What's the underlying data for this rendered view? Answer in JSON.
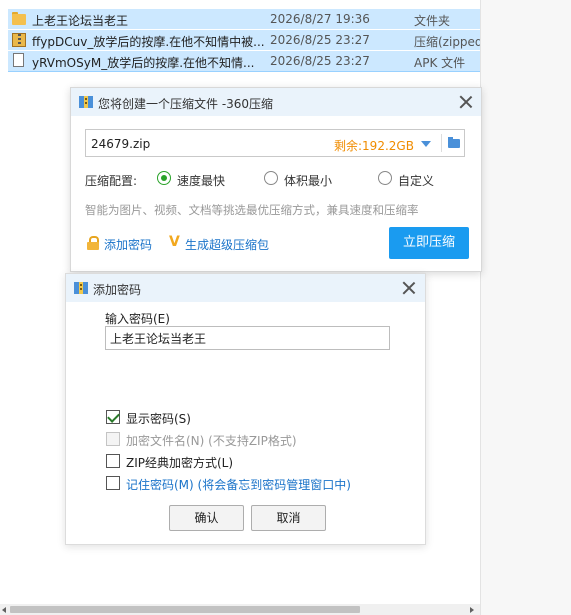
{
  "files": [
    {
      "name": "上老王论坛当老王",
      "date": "2026/8/27 19:36",
      "type": "文件夹",
      "icon": "folder-icon"
    },
    {
      "name": "ffypDCuv_放学后的按摩.在他不知情中被...",
      "date": "2026/8/25 23:27",
      "type": "压缩(zipped",
      "icon": "zip-file-icon"
    },
    {
      "name": "yRVmOSyM_放学后的按摩.在他不知情...",
      "date": "2026/8/25 23:27",
      "type": "APK 文件",
      "icon": "apk-file-icon"
    }
  ],
  "compress_dialog": {
    "title": "您将创建一个压缩文件 -360压缩",
    "path_value": "24679.zip",
    "free_space": "剩余:192.2GB",
    "config_label": "压缩配置:",
    "options": [
      "速度最快",
      "体积最小",
      "自定义"
    ],
    "selected_option": "速度最快",
    "hint": "智能为图片、视频、文档等挑选最优压缩方式，兼具速度和压缩率",
    "add_password": "添加密码",
    "super_pack": "生成超级压缩包",
    "compress_button": "立即压缩"
  },
  "password_dialog": {
    "title": "添加密码",
    "input_label": "输入密码(E)",
    "password_value": "上老王论坛当老王",
    "show_password": "显示密码(S)",
    "encrypt_names": "加密文件名(N) (不支持ZIP格式)",
    "zip_classic": "ZIP经典加密方式(L)",
    "remember": "记住密码(M) (将会备忘到密码管理窗口中)",
    "ok": "确认",
    "cancel": "取消"
  },
  "colors": {
    "accent": "#1a9bf0",
    "free_space": "#f08c00",
    "selection": "#cce8ff",
    "link": "#1a73c9",
    "radio_selected": "#2aa32a"
  }
}
